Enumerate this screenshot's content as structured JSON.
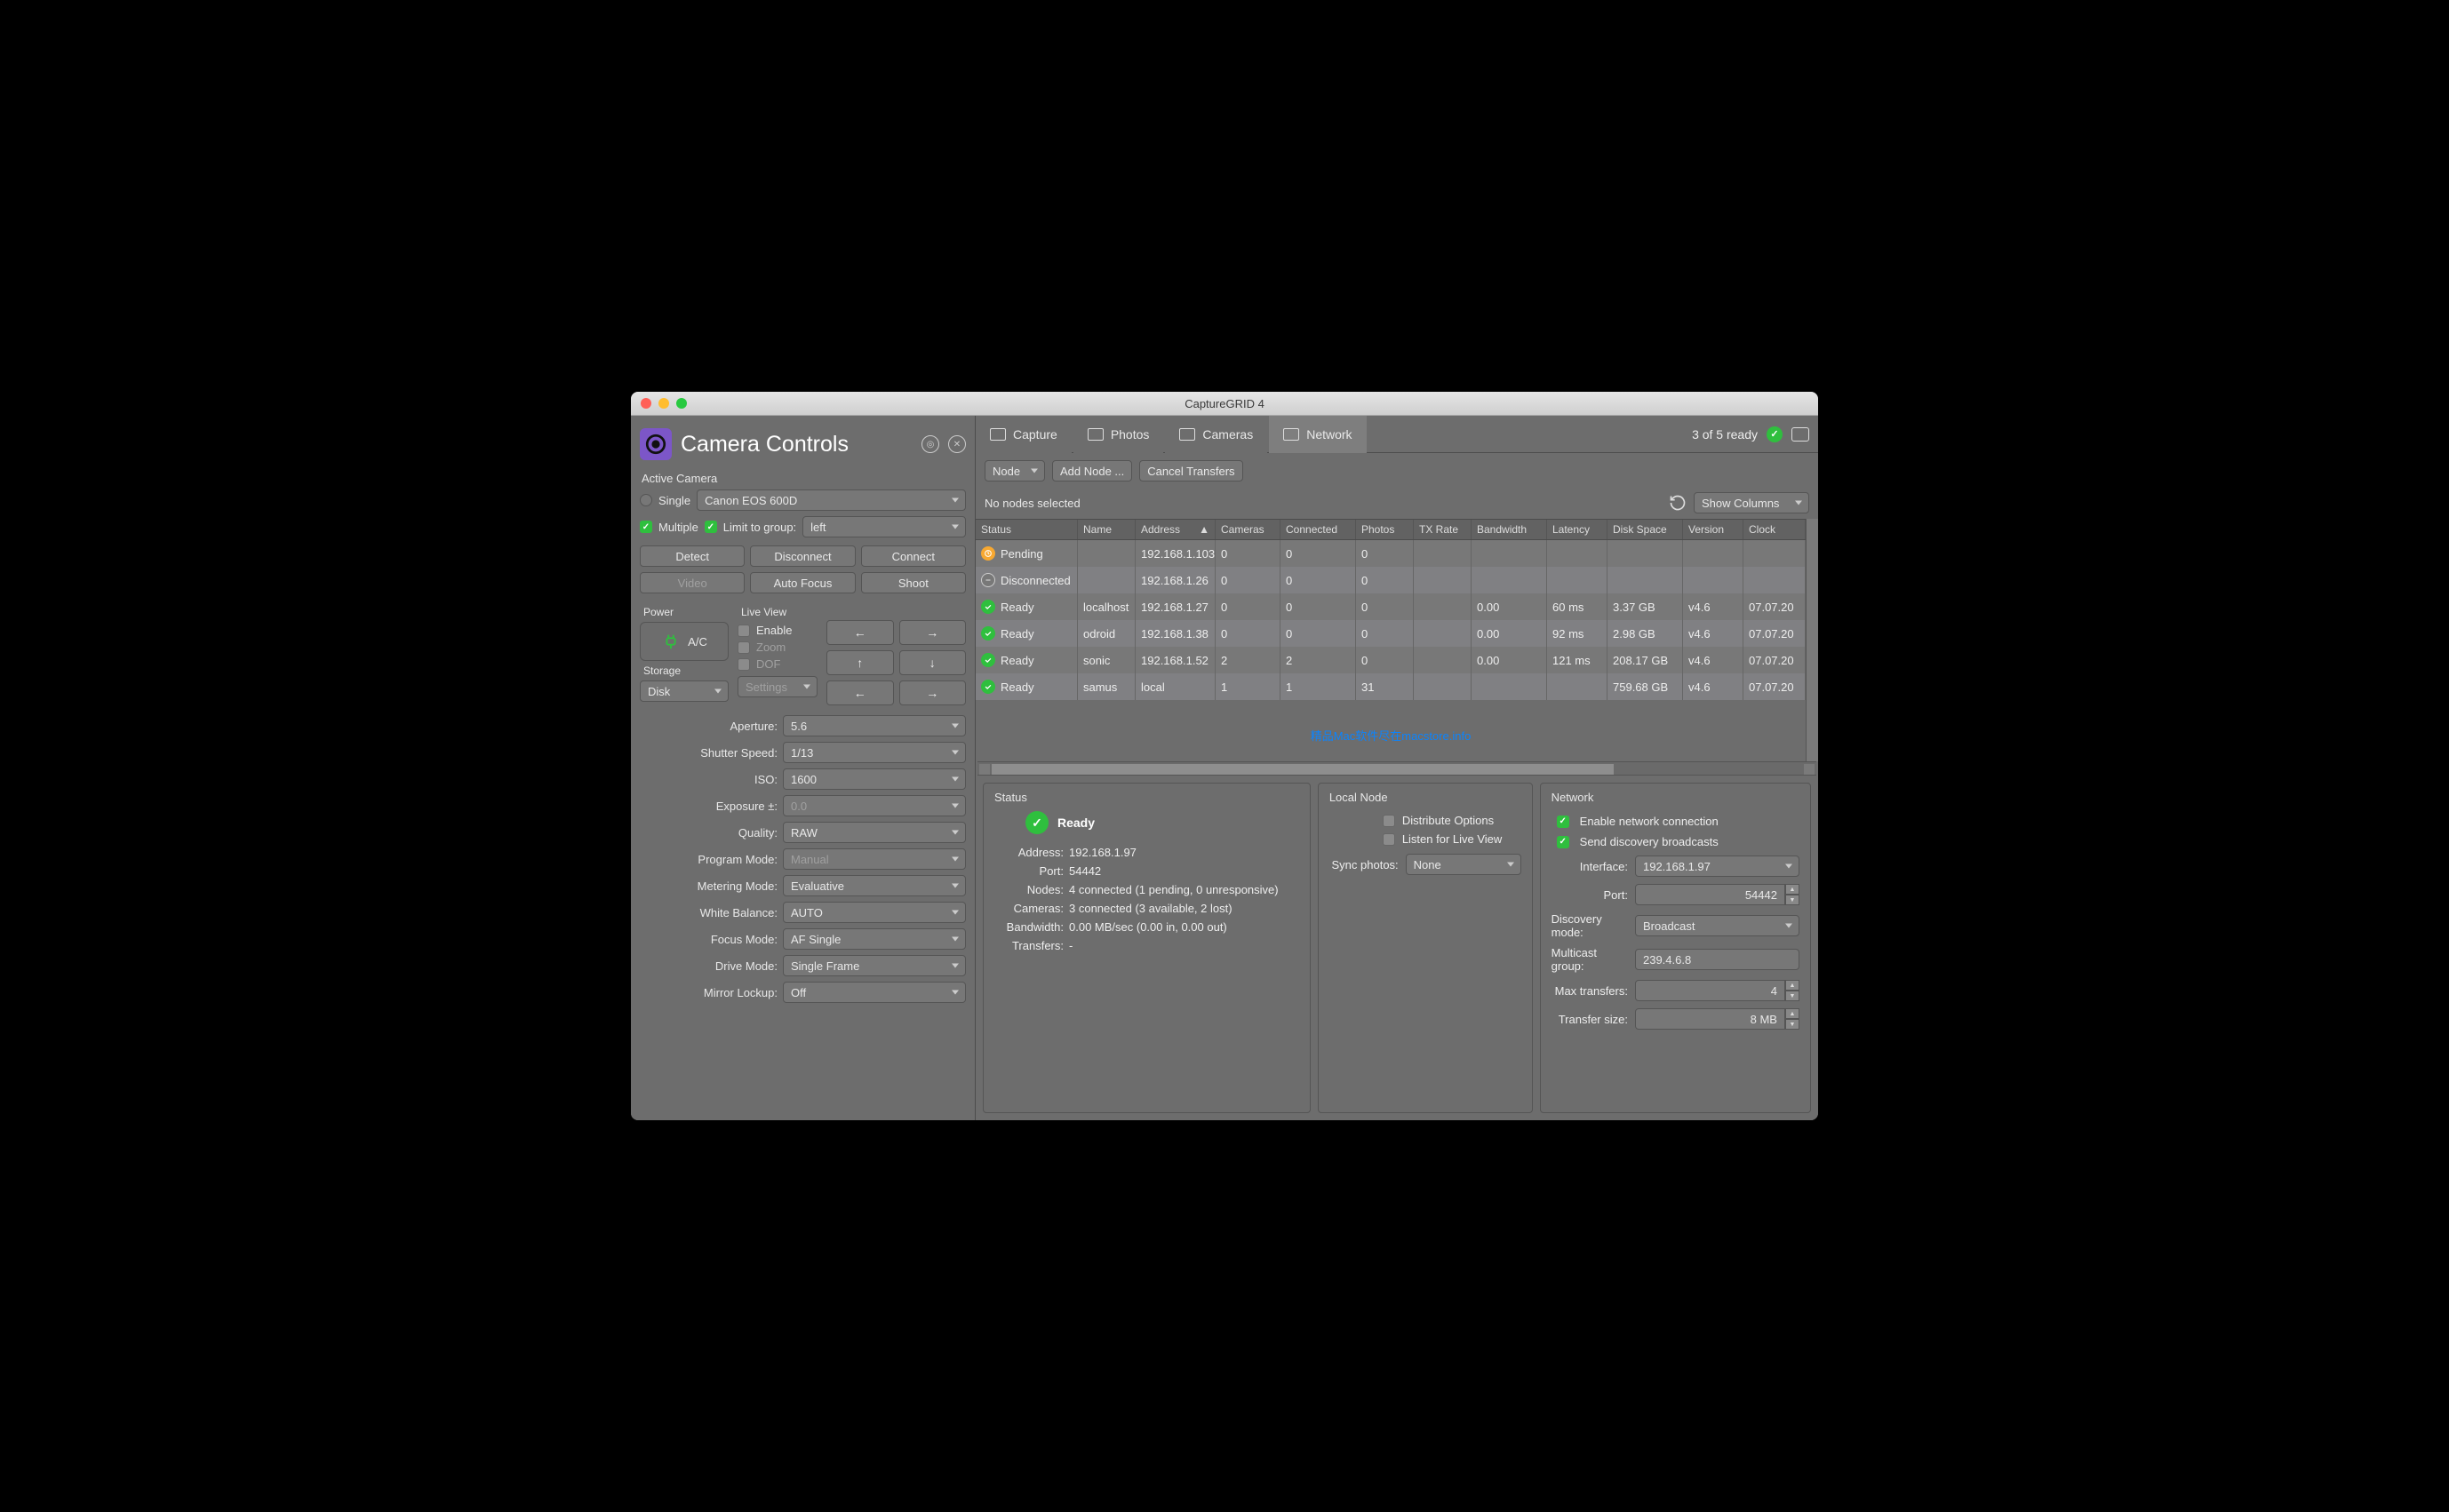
{
  "window": {
    "title": "CaptureGRID 4"
  },
  "sidebar": {
    "title": "Camera Controls",
    "active_camera": {
      "heading": "Active Camera",
      "single_label": "Single",
      "single_value": "Canon EOS 600D",
      "multiple_label": "Multiple",
      "limit_label": "Limit to group:",
      "limit_value": "left"
    },
    "buttons": {
      "detect": "Detect",
      "disconnect": "Disconnect",
      "connect": "Connect",
      "video": "Video",
      "autofocus": "Auto Focus",
      "shoot": "Shoot"
    },
    "power_h": "Power",
    "power_val": "A/C",
    "storage_h": "Storage",
    "storage_val": "Disk",
    "liveview_h": "Live View",
    "lv": {
      "enable": "Enable",
      "zoom": "Zoom",
      "dof": "DOF",
      "settings": "Settings"
    },
    "settings": {
      "aperture_k": "Aperture:",
      "aperture_v": "5.6",
      "shutter_k": "Shutter Speed:",
      "shutter_v": "1/13",
      "iso_k": "ISO:",
      "iso_v": "1600",
      "exposure_k": "Exposure ±:",
      "exposure_v": "0.0",
      "quality_k": "Quality:",
      "quality_v": "RAW",
      "program_k": "Program Mode:",
      "program_v": "Manual",
      "metering_k": "Metering Mode:",
      "metering_v": "Evaluative",
      "wb_k": "White Balance:",
      "wb_v": "AUTO",
      "focus_k": "Focus Mode:",
      "focus_v": "AF Single",
      "drive_k": "Drive Mode:",
      "drive_v": "Single Frame",
      "mirror_k": "Mirror Lockup:",
      "mirror_v": "Off"
    }
  },
  "tabs": {
    "capture": "Capture",
    "photos": "Photos",
    "cameras": "Cameras",
    "network": "Network"
  },
  "status_line": "3 of 5 ready",
  "toolbar": {
    "node": "Node",
    "add": "Add Node ...",
    "cancel": "Cancel Transfers"
  },
  "info_line": "No nodes selected",
  "show_cols": "Show Columns",
  "cols": {
    "status": "Status",
    "name": "Name",
    "address": "Address",
    "cameras": "Cameras",
    "connected": "Connected",
    "photos": "Photos",
    "tx": "TX Rate",
    "bw": "Bandwidth",
    "lat": "Latency",
    "disk": "Disk Space",
    "ver": "Version",
    "clock": "Clock"
  },
  "rows": [
    {
      "status": "Pending",
      "stype": "pending",
      "name": "",
      "addr": "192.168.1.103",
      "cameras": "0",
      "conn": "0",
      "photos": "0",
      "tx": "",
      "bw": "",
      "lat": "",
      "disk": "",
      "ver": "",
      "clock": ""
    },
    {
      "status": "Disconnected",
      "stype": "disc",
      "name": "",
      "addr": "192.168.1.26",
      "cameras": "0",
      "conn": "0",
      "photos": "0",
      "tx": "",
      "bw": "",
      "lat": "",
      "disk": "",
      "ver": "",
      "clock": ""
    },
    {
      "status": "Ready",
      "stype": "ready",
      "name": "localhost",
      "addr": "192.168.1.27",
      "cameras": "0",
      "conn": "0",
      "photos": "0",
      "tx": "",
      "bw": "0.00",
      "lat": "60 ms",
      "disk": "3.37 GB",
      "ver": "v4.6",
      "clock": "07.07.20"
    },
    {
      "status": "Ready",
      "stype": "ready",
      "name": "odroid",
      "addr": "192.168.1.38",
      "cameras": "0",
      "conn": "0",
      "photos": "0",
      "tx": "",
      "bw": "0.00",
      "lat": "92 ms",
      "disk": "2.98 GB",
      "ver": "v4.6",
      "clock": "07.07.20"
    },
    {
      "status": "Ready",
      "stype": "ready",
      "name": "sonic",
      "addr": "192.168.1.52",
      "cameras": "2",
      "conn": "2",
      "photos": "0",
      "tx": "",
      "bw": "0.00",
      "lat": "121 ms",
      "disk": "208.17 GB",
      "ver": "v4.6",
      "clock": "07.07.20"
    },
    {
      "status": "Ready",
      "stype": "ready",
      "name": "samus",
      "addr": "local",
      "cameras": "1",
      "conn": "1",
      "photos": "31",
      "tx": "",
      "bw": "",
      "lat": "",
      "disk": "759.68 GB",
      "ver": "v4.6",
      "clock": "07.07.20"
    }
  ],
  "watermark": "精品Mac软件尽在macstore.info",
  "status_panel": {
    "title": "Status",
    "ready": "Ready",
    "addr_k": "Address:",
    "addr_v": "192.168.1.97",
    "port_k": "Port:",
    "port_v": "54442",
    "nodes_k": "Nodes:",
    "nodes_v": "4 connected (1 pending, 0 unresponsive)",
    "cams_k": "Cameras:",
    "cams_v": "3 connected (3 available, 2 lost)",
    "bw_k": "Bandwidth:",
    "bw_v": "0.00 MB/sec (0.00 in, 0.00 out)",
    "tx_k": "Transfers:",
    "tx_v": "-"
  },
  "local_panel": {
    "title": "Local Node",
    "distribute": "Distribute Options",
    "listen": "Listen for Live View",
    "sync_k": "Sync photos:",
    "sync_v": "None"
  },
  "net_panel": {
    "title": "Network",
    "enable": "Enable network connection",
    "broadcast": "Send discovery broadcasts",
    "iface_k": "Interface:",
    "iface_v": "192.168.1.97",
    "port_k": "Port:",
    "port_v": "54442",
    "disc_k": "Discovery mode:",
    "disc_v": "Broadcast",
    "multi_k": "Multicast group:",
    "multi_v": "239.4.6.8",
    "max_k": "Max transfers:",
    "max_v": "4",
    "size_k": "Transfer size:",
    "size_v": "8 MB"
  }
}
